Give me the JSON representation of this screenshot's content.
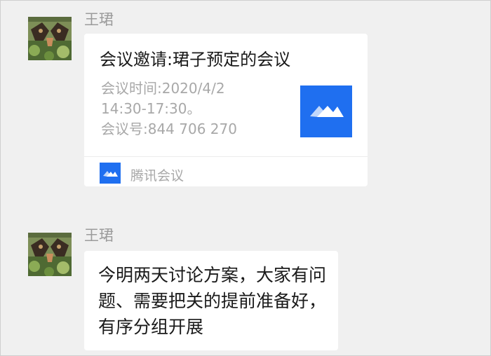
{
  "messages": [
    {
      "sender": "王珺",
      "card": {
        "title": "会议邀请:珺子预定的会议",
        "time_line1": "会议时间:2020/4/2",
        "time_line2": "14:30-17:30。",
        "meeting_id_line": "会议号:844 706 270",
        "app_icon": "tencent-meeting-logo",
        "app_name": "腾讯会议"
      }
    },
    {
      "sender": "王珺",
      "text_lines": [
        "今明两天讨论方案，大家有问",
        "题、需要把关的提前准备好，",
        "有序分组开展"
      ]
    }
  ],
  "colors": {
    "background": "#f0f0f0",
    "bubble": "#ffffff",
    "brand_blue": "#1f6ff0",
    "muted_text": "#a8a8a8",
    "sender_text": "#9b9b9b"
  }
}
